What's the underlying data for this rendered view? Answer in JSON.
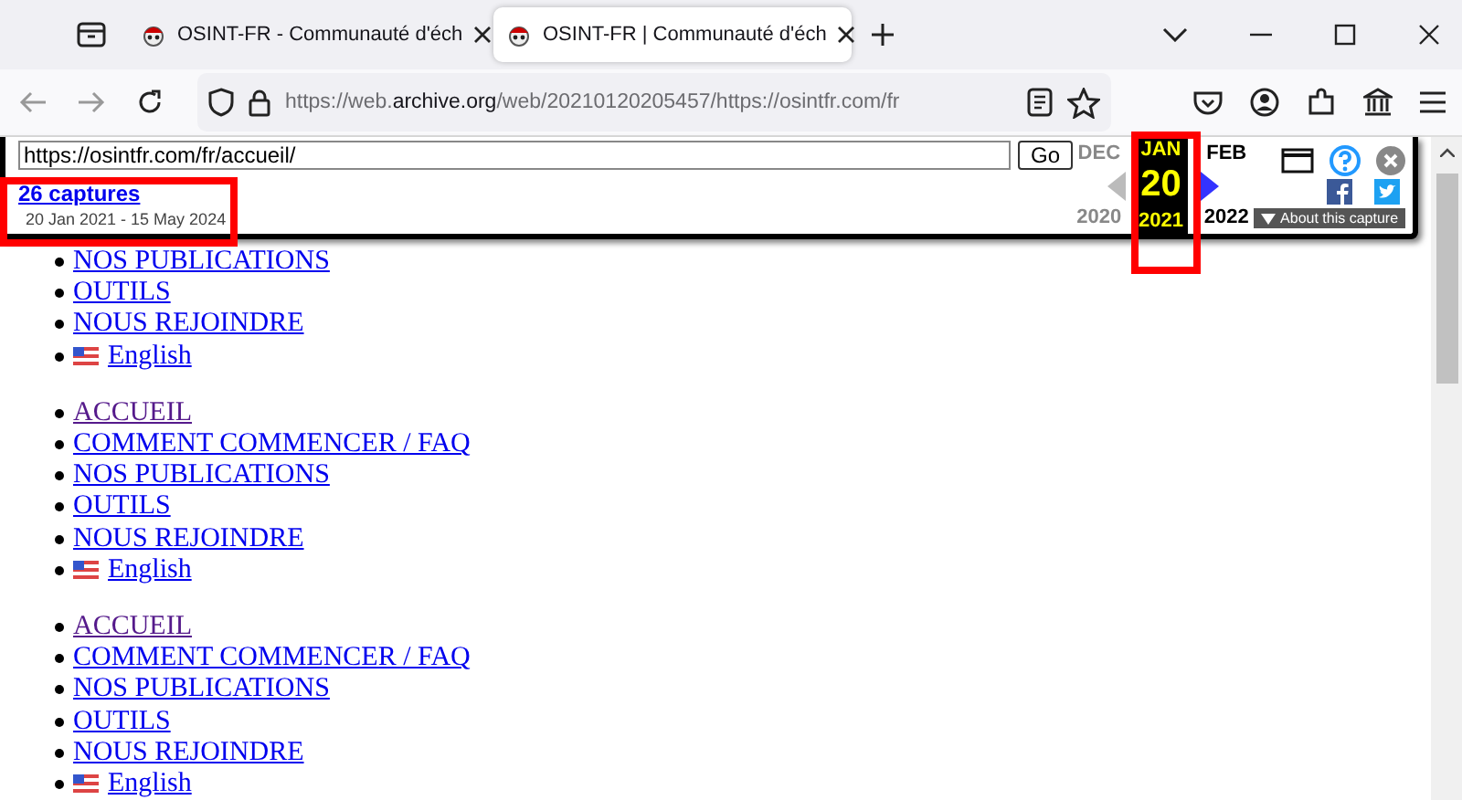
{
  "tabs": [
    {
      "title": "OSINT-FR - Communauté d'éch",
      "selected": false
    },
    {
      "title": "OSINT-FR | Communauté d'éch",
      "selected": true
    }
  ],
  "address_bar": {
    "url_prefix": "https://web.",
    "url_domain": "archive.org",
    "url_suffix": "/web/20210120205457/https://osintfr.com/fr"
  },
  "wayback": {
    "url_value": "https://osintfr.com/fr/accueil/",
    "go": "Go",
    "captures": "26 captures",
    "date_range": "20 Jan 2021 - 15 May 2024",
    "prev": {
      "month": "DEC",
      "year": "2020"
    },
    "current": {
      "month": "JAN",
      "day": "20",
      "year": "2021"
    },
    "next": {
      "month": "FEB",
      "year": "2022"
    },
    "about": "About this capture"
  },
  "page": {
    "lists": [
      [
        {
          "label": "NOS PUBLICATIONS",
          "visited": false,
          "kind": "link"
        },
        {
          "label": "OUTILS",
          "visited": false,
          "kind": "link"
        },
        {
          "label": "NOUS REJOINDRE",
          "visited": false,
          "kind": "link"
        },
        {
          "label": "English",
          "visited": false,
          "kind": "flag-link"
        }
      ],
      [
        {
          "label": "ACCUEIL",
          "visited": true,
          "kind": "link"
        },
        {
          "label": "COMMENT COMMENCER / FAQ",
          "visited": false,
          "kind": "link"
        },
        {
          "label": "NOS PUBLICATIONS",
          "visited": false,
          "kind": "link"
        },
        {
          "label": "OUTILS",
          "visited": false,
          "kind": "link"
        },
        {
          "label": "NOUS REJOINDRE",
          "visited": false,
          "kind": "link"
        },
        {
          "label": "English",
          "visited": false,
          "kind": "flag-link"
        }
      ],
      [
        {
          "label": "ACCUEIL",
          "visited": true,
          "kind": "link"
        },
        {
          "label": "COMMENT COMMENCER / FAQ",
          "visited": false,
          "kind": "link"
        },
        {
          "label": "NOS PUBLICATIONS",
          "visited": false,
          "kind": "link"
        },
        {
          "label": "OUTILS",
          "visited": false,
          "kind": "link"
        },
        {
          "label": "NOUS REJOINDRE",
          "visited": false,
          "kind": "link"
        },
        {
          "label": "English",
          "visited": false,
          "kind": "flag-link"
        }
      ]
    ]
  }
}
